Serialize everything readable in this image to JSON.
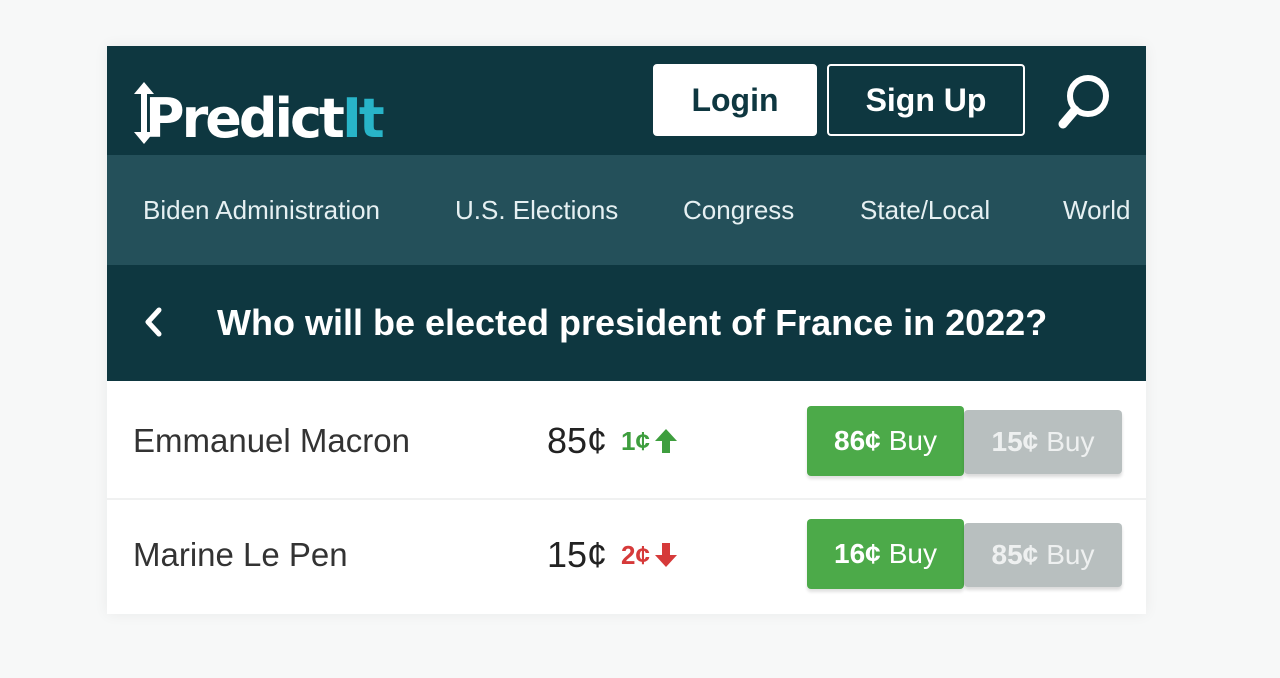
{
  "header": {
    "logo": {
      "part1": "Predict",
      "part2": "It"
    },
    "login_label": "Login",
    "signup_label": "Sign Up"
  },
  "nav": {
    "items": [
      {
        "label": "Biden Administration"
      },
      {
        "label": "U.S. Elections"
      },
      {
        "label": "Congress"
      },
      {
        "label": "State/Local"
      },
      {
        "label": "World"
      }
    ]
  },
  "market": {
    "title": "Who will be elected president of France in 2022?",
    "contracts": [
      {
        "name": "Emmanuel Macron",
        "price": "85¢",
        "change": "1¢",
        "direction": "up",
        "buy_yes_price": "86¢",
        "buy_no_price": "15¢",
        "buy_label": "Buy"
      },
      {
        "name": "Marine Le Pen",
        "price": "15¢",
        "change": "2¢",
        "direction": "down",
        "buy_yes_price": "16¢",
        "buy_no_price": "85¢",
        "buy_label": "Buy"
      }
    ]
  },
  "colors": {
    "header_bg": "#0e3740",
    "nav_bg": "#24505a",
    "accent_teal": "#28b4c8",
    "buy_green": "#4caa49",
    "buy_grey": "#b8bfbf",
    "up_green": "#3e9e3e",
    "down_red": "#d63a3a"
  }
}
